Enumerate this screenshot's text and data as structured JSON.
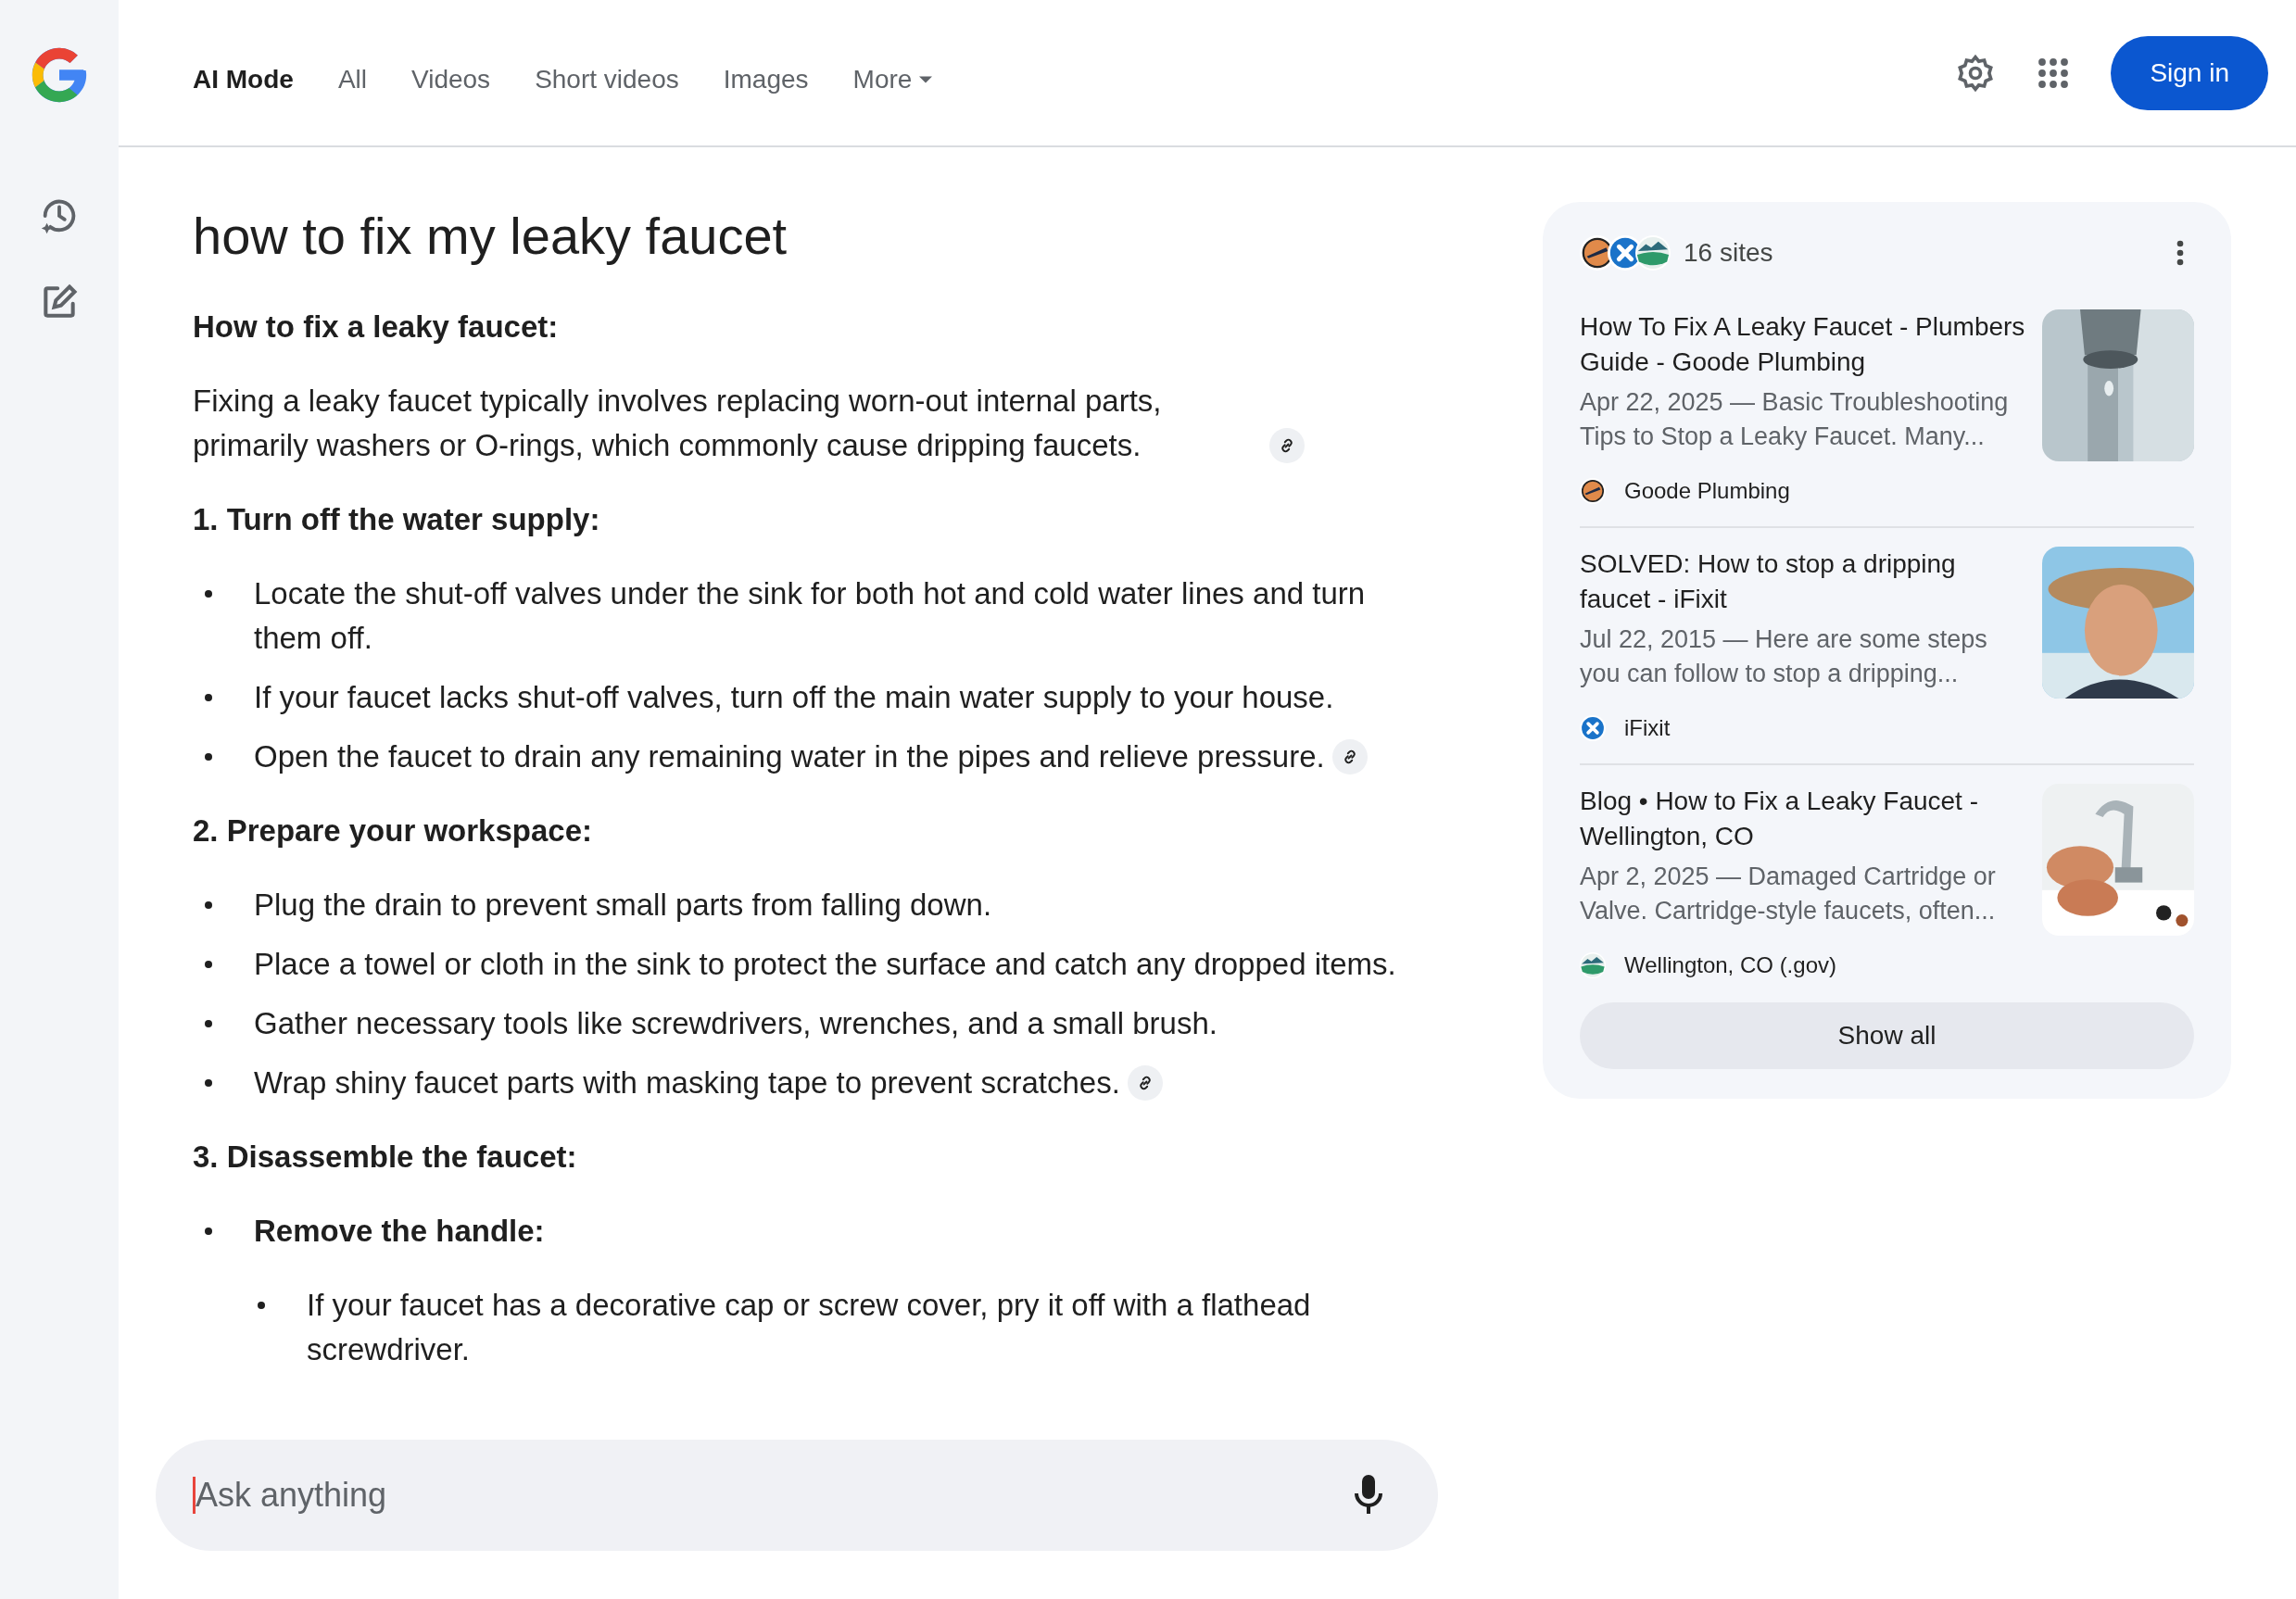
{
  "tabs": [
    {
      "label": "AI Mode",
      "selected": true
    },
    {
      "label": "All",
      "selected": false
    },
    {
      "label": "Videos",
      "selected": false
    },
    {
      "label": "Short videos",
      "selected": false
    },
    {
      "label": "Images",
      "selected": false
    },
    {
      "label": "More",
      "selected": false,
      "kind": "dropdown"
    }
  ],
  "sign_in": "Sign in",
  "query": "how to fix my leaky faucet",
  "answer": [
    {
      "kind": "heading",
      "text": "How to fix a leaky faucet:"
    },
    {
      "kind": "paragraph",
      "text": "Fixing a leaky faucet typically involves replacing worn-out internal parts, primarily washers or O-rings, which commonly cause dripping faucets.",
      "source_link": true
    },
    {
      "kind": "heading",
      "text": "1. Turn off the water supply:"
    },
    {
      "kind": "bullets",
      "items": [
        {
          "text": "Locate the shut-off valves under the sink for both hot and cold water lines and turn them off.",
          "source_link": false
        },
        {
          "text": "If your faucet lacks shut-off valves, turn off the main water supply to your house.",
          "source_link": false
        },
        {
          "text": "Open the faucet to drain any remaining water in the pipes and relieve pressure.",
          "source_link": true
        }
      ]
    },
    {
      "kind": "heading",
      "text": "2. Prepare your workspace:"
    },
    {
      "kind": "bullets",
      "items": [
        {
          "text": "Plug the drain to prevent small parts from falling down.",
          "source_link": false
        },
        {
          "text": "Place a towel or cloth in the sink to protect the surface and catch any dropped items.",
          "source_link": false
        },
        {
          "text": "Gather necessary tools like screwdrivers, wrenches, and a small brush.",
          "source_link": false
        },
        {
          "text": "Wrap shiny faucet parts with masking tape to prevent scratches.",
          "source_link": true
        }
      ]
    },
    {
      "kind": "heading",
      "text": "3. Disassemble the faucet:"
    },
    {
      "kind": "bullets",
      "items": [
        {
          "text": "Remove the handle:",
          "bold": true,
          "source_link": false,
          "children": [
            {
              "text": "If your faucet has a decorative cap or screw cover, pry it off with a flathead screwdriver.",
              "source_link": false
            }
          ]
        }
      ]
    }
  ],
  "ask": {
    "placeholder": "Ask anything"
  },
  "sources": {
    "count": "16 sites",
    "show_all": "Show all",
    "items": [
      {
        "title": "How To Fix A Leaky Faucet - Plumbers Guide - Goode Plumbing",
        "snippet": "Apr 22, 2025 — Basic Troubleshooting Tips to Stop a Leaky Faucet. Many...",
        "site": "Goode Plumbing",
        "kind": "plumber"
      },
      {
        "title": "SOLVED: How to stop a dripping faucet - iFixit",
        "snippet": "Jul 22, 2015 — Here are some steps you can follow to stop a dripping...",
        "site": "iFixit",
        "kind": "ifixit"
      },
      {
        "title": "Blog • How to Fix a Leaky Faucet - Wellington, CO",
        "snippet": "Apr 2, 2025 — Damaged Cartridge or Valve. Cartridge-style faucets, often...",
        "site": "Wellington, CO (.gov)",
        "kind": "gov"
      }
    ]
  }
}
